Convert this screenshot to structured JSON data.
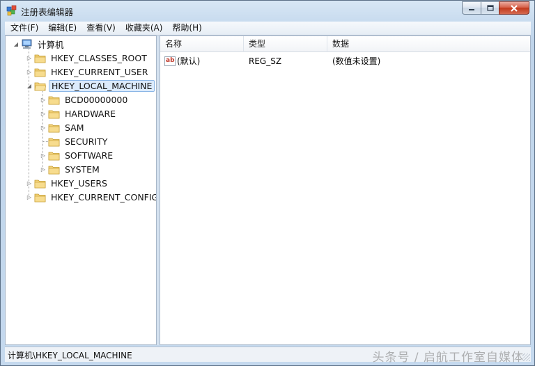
{
  "window": {
    "title": "注册表编辑器"
  },
  "menu": [
    "文件(F)",
    "编辑(E)",
    "查看(V)",
    "收藏夹(A)",
    "帮助(H)"
  ],
  "tree": {
    "root": "计算机",
    "hives": [
      {
        "label": "HKEY_CLASSES_ROOT",
        "expanded": false
      },
      {
        "label": "HKEY_CURRENT_USER",
        "expanded": false
      },
      {
        "label": "HKEY_LOCAL_MACHINE",
        "expanded": true,
        "selected": true,
        "children": [
          "BCD00000000",
          "HARDWARE",
          "SAM",
          "SECURITY",
          "SOFTWARE",
          "SYSTEM"
        ]
      },
      {
        "label": "HKEY_USERS",
        "expanded": false
      },
      {
        "label": "HKEY_CURRENT_CONFIG",
        "expanded": false
      }
    ]
  },
  "list": {
    "columns": [
      "名称",
      "类型",
      "数据"
    ],
    "rows": [
      {
        "name": "(默认)",
        "type": "REG_SZ",
        "data": "(数值未设置)",
        "icon": "string-value-icon"
      }
    ]
  },
  "status": {
    "path": "计算机\\HKEY_LOCAL_MACHINE"
  },
  "watermark": "头条号 / 启航工作室自媒体",
  "colors": {
    "selection": "#dcebfc",
    "folder": "#f3d27a",
    "close_button": "#c2391c"
  }
}
